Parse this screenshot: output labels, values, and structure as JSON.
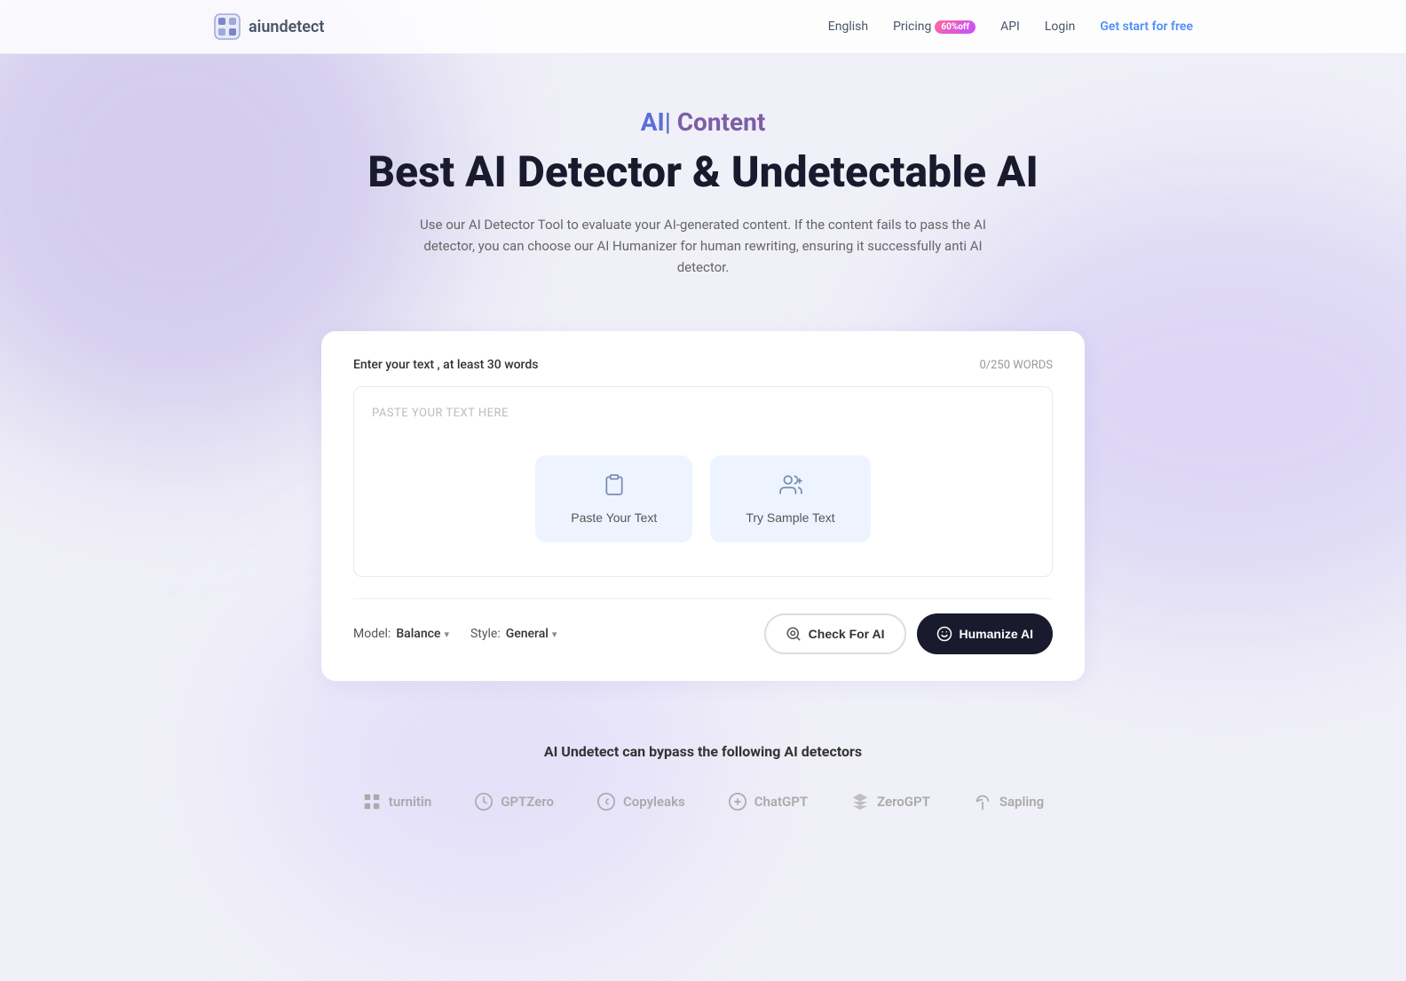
{
  "header": {
    "logo_text": "aiundetect",
    "nav": {
      "language": "English",
      "pricing": "Pricing",
      "pricing_badge": "60%off",
      "api": "API",
      "login": "Login",
      "get_started": "Get start for free"
    }
  },
  "hero": {
    "subtitle_ai": "AI|",
    "subtitle_content": "Content",
    "title": "Best AI Detector & Undetectable AI",
    "description": "Use our AI Detector Tool to evaluate your AI-generated content. If the content fails to pass the AI detector, you can choose our AI Humanizer for human rewriting, ensuring it successfully anti AI detector."
  },
  "card": {
    "input_label": "Enter your text , at least 30 words",
    "word_count": "0/250 WORDS",
    "placeholder": "PASTE YOUR TEXT HERE",
    "paste_btn": "Paste Your Text",
    "sample_btn": "Try Sample Text",
    "model_label": "Model:",
    "model_value": "Balance",
    "style_label": "Style:",
    "style_value": "General",
    "check_btn": "Check For AI",
    "humanize_btn": "Humanize AI"
  },
  "detectors": {
    "title": "AI Undetect can bypass the following AI detectors",
    "logos": [
      {
        "name": "turnitin",
        "icon": "T"
      },
      {
        "name": "GPTZero",
        "icon": "G"
      },
      {
        "name": "Copyleaks",
        "icon": "C"
      },
      {
        "name": "ChatGPT",
        "icon": "⊕"
      },
      {
        "name": "ZeroGPT",
        "icon": "Z"
      },
      {
        "name": "Sapling",
        "icon": "S"
      }
    ]
  }
}
